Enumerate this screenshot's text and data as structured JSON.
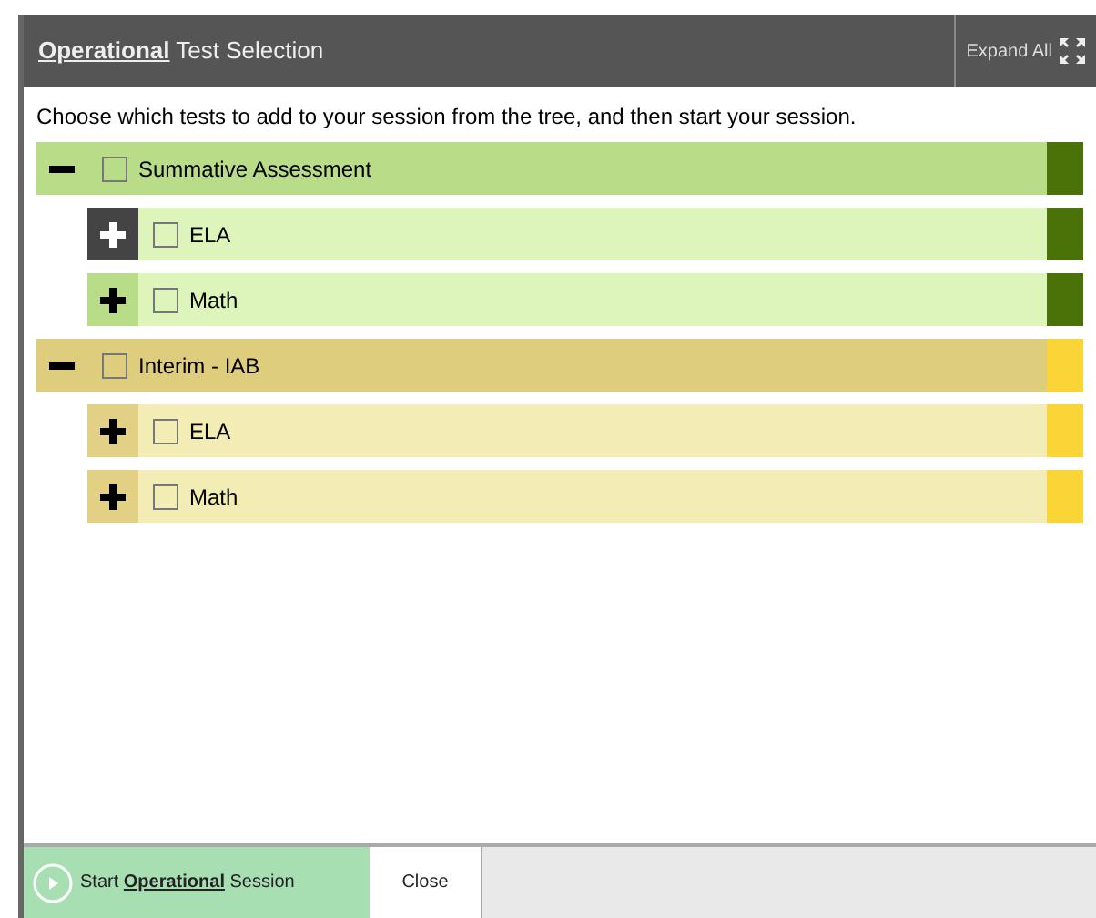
{
  "window": {
    "title": "**Operational** Test Selection",
    "expand_all": "Expand All"
  },
  "instructions": "Choose which tests to add to your session from the tree, and then start your session.",
  "tree": [
    {
      "label": "Summative Assessment",
      "kind": "summative",
      "color": "#4a7208",
      "expanded": true,
      "checked": false,
      "focused": false,
      "children": [
        {
          "label": "ELA",
          "expanded": false,
          "checked": false,
          "focused": true
        },
        {
          "label": "Math",
          "expanded": false,
          "checked": false,
          "focused": false
        }
      ]
    },
    {
      "label": "Interim - IAB",
      "kind": "interim",
      "color": "#fbd535",
      "expanded": true,
      "checked": false,
      "focused": false,
      "children": [
        {
          "label": "ELA",
          "expanded": false,
          "checked": false,
          "focused": false
        },
        {
          "label": "Math",
          "expanded": false,
          "checked": false,
          "focused": false
        }
      ]
    }
  ],
  "footer": {
    "start_button": "Start **Operational** Session",
    "close_button": "Close"
  }
}
